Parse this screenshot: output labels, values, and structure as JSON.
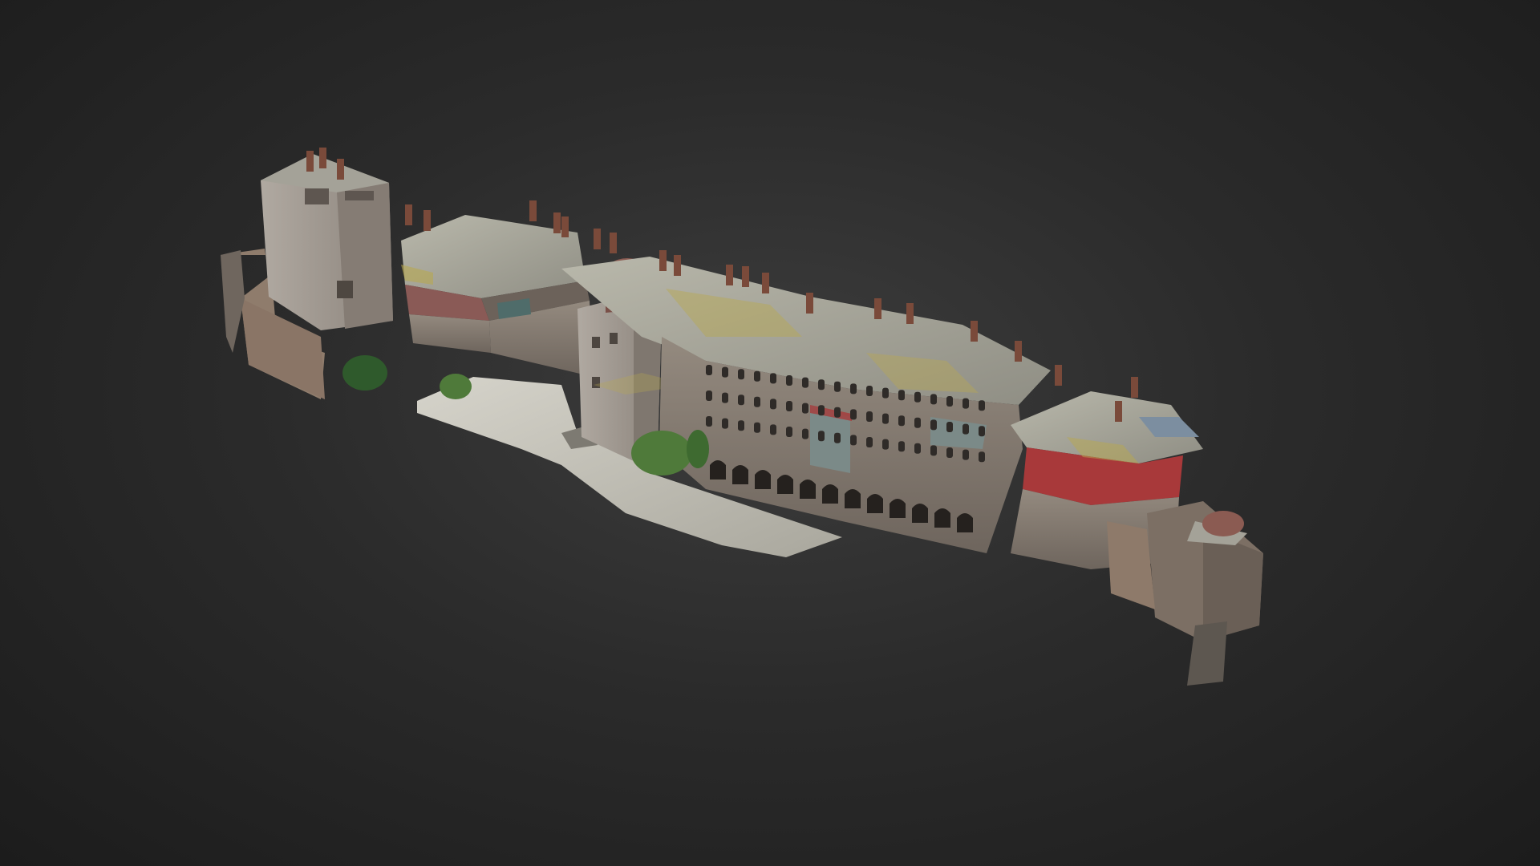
{
  "viewer": {
    "background_color": "#2e2e2e",
    "subject": "3d-model-monastery",
    "colors": {
      "roof": "#a7a69a",
      "roof_moss": "#b8a850",
      "stone_wall": "#8a7f74",
      "stone_dark": "#6c625a",
      "red_wooden_upper_floor": "#a8393a",
      "courtyard_paving": "#c9c7bd",
      "chimney": "#7a4a3a",
      "dome": "#7a5048",
      "foliage": "#4f7a3a",
      "untextured_wall": "#8e7a6a"
    }
  }
}
